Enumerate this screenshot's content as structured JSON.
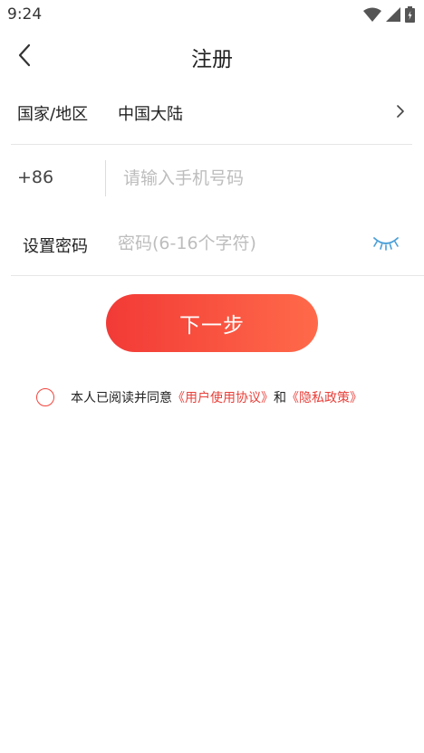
{
  "status_bar": {
    "time": "9:24",
    "icons": [
      "wifi-icon",
      "signal-icon",
      "battery-icon"
    ]
  },
  "header": {
    "title": "注册",
    "back_icon": "chevron-left-icon"
  },
  "form": {
    "country": {
      "label": "国家/地区",
      "value": "中国大陆"
    },
    "phone": {
      "prefix": "+86",
      "placeholder": "请输入手机号码",
      "value": ""
    },
    "password": {
      "label": "设置密码",
      "placeholder": "密码(6-16个字符)",
      "value": "",
      "toggle_icon": "eye-closed-icon"
    },
    "next_label": "下一步"
  },
  "agreement": {
    "prefix": "本人已阅读并同意",
    "user_agreement": "《用户使用协议》",
    "conjunction": "和",
    "privacy_policy": "《隐私政策》",
    "checked": false
  },
  "colors": {
    "accent": "#f23a36",
    "accent_end": "#ff6a4a",
    "link": "#e8403a",
    "eye_icon": "#4a9fd8",
    "placeholder": "#bdbdbd"
  }
}
